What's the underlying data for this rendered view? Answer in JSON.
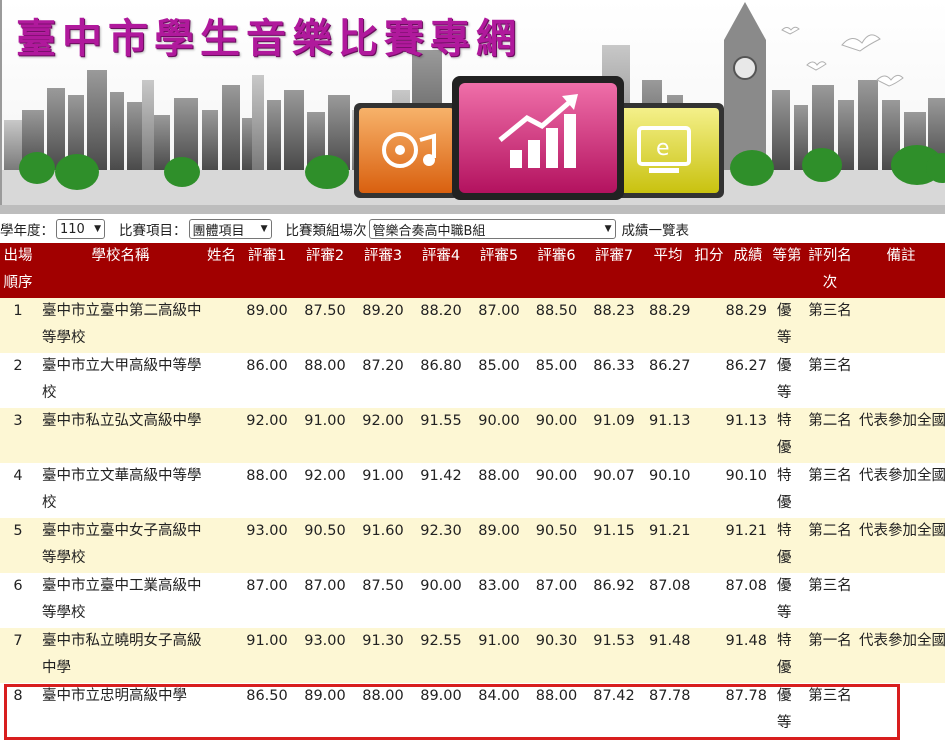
{
  "banner": {
    "title": "臺中市學生音樂比賽專網",
    "icons": [
      "music-disc-icon",
      "growth-chart-icon",
      "monitor-e-icon"
    ]
  },
  "filters": {
    "year_label": "學年度：",
    "year_value": "110",
    "item_label": "比賽項目：",
    "item_value": "團體項目",
    "group_label": "比賽類組場次",
    "group_value": "管樂合奏高中職B組",
    "link_text": "成績一覽表"
  },
  "table": {
    "headers": [
      "出場順序",
      "學校名稱",
      "姓名",
      "評審1",
      "評審2",
      "評審3",
      "評審4",
      "評審5",
      "評審6",
      "評審7",
      "平均",
      "扣分",
      "成績",
      "等第",
      "評列名次",
      "備註"
    ],
    "rows": [
      {
        "no": "1",
        "school": "臺中市立臺中第二高級中等學校",
        "name": "",
        "j1": "89.00",
        "j2": "87.50",
        "j3": "89.20",
        "j4": "88.20",
        "j5": "87.00",
        "j6": "88.50",
        "j7": "88.23",
        "avg": "88.29",
        "ded": "",
        "score": "88.29",
        "grade": "優等",
        "rank": "第三名",
        "note": ""
      },
      {
        "no": "2",
        "school": "臺中市立大甲高級中等學校",
        "name": "",
        "j1": "86.00",
        "j2": "88.00",
        "j3": "87.20",
        "j4": "86.80",
        "j5": "85.00",
        "j6": "85.00",
        "j7": "86.33",
        "avg": "86.27",
        "ded": "",
        "score": "86.27",
        "grade": "優等",
        "rank": "第三名",
        "note": ""
      },
      {
        "no": "3",
        "school": "臺中市私立弘文高級中學",
        "name": "",
        "j1": "92.00",
        "j2": "91.00",
        "j3": "92.00",
        "j4": "91.55",
        "j5": "90.00",
        "j6": "90.00",
        "j7": "91.09",
        "avg": "91.13",
        "ded": "",
        "score": "91.13",
        "grade": "特優",
        "rank": "第二名",
        "note": "代表參加全國決賽"
      },
      {
        "no": "4",
        "school": "臺中市立文華高級中等學校",
        "name": "",
        "j1": "88.00",
        "j2": "92.00",
        "j3": "91.00",
        "j4": "91.42",
        "j5": "88.00",
        "j6": "90.00",
        "j7": "90.07",
        "avg": "90.10",
        "ded": "",
        "score": "90.10",
        "grade": "特優",
        "rank": "第三名",
        "note": "代表參加全國決賽"
      },
      {
        "no": "5",
        "school": "臺中市立臺中女子高級中等學校",
        "name": "",
        "j1": "93.00",
        "j2": "90.50",
        "j3": "91.60",
        "j4": "92.30",
        "j5": "89.00",
        "j6": "90.50",
        "j7": "91.15",
        "avg": "91.21",
        "ded": "",
        "score": "91.21",
        "grade": "特優",
        "rank": "第二名",
        "note": "代表參加全國決賽"
      },
      {
        "no": "6",
        "school": "臺中市立臺中工業高級中等學校",
        "name": "",
        "j1": "87.00",
        "j2": "87.00",
        "j3": "87.50",
        "j4": "90.00",
        "j5": "83.00",
        "j6": "87.00",
        "j7": "86.92",
        "avg": "87.08",
        "ded": "",
        "score": "87.08",
        "grade": "優等",
        "rank": "第三名",
        "note": ""
      },
      {
        "no": "7",
        "school": "臺中市私立曉明女子高級中學",
        "name": "",
        "j1": "91.00",
        "j2": "93.00",
        "j3": "91.30",
        "j4": "92.55",
        "j5": "91.00",
        "j6": "90.30",
        "j7": "91.53",
        "avg": "91.48",
        "ded": "",
        "score": "91.48",
        "grade": "特優",
        "rank": "第一名",
        "note": "代表參加全國決賽"
      },
      {
        "no": "8",
        "school": "臺中市立忠明高級中學",
        "name": "",
        "j1": "86.50",
        "j2": "89.00",
        "j3": "88.00",
        "j4": "89.00",
        "j5": "84.00",
        "j6": "88.00",
        "j7": "87.42",
        "avg": "87.78",
        "ded": "",
        "score": "87.78",
        "grade": "優等",
        "rank": "第三名",
        "note": ""
      }
    ]
  },
  "colors": {
    "header_bg": "#a10000",
    "odd_row_bg": "#fdf7d4",
    "title_color": "#b0199c",
    "highlight_border": "#d81e1e"
  }
}
